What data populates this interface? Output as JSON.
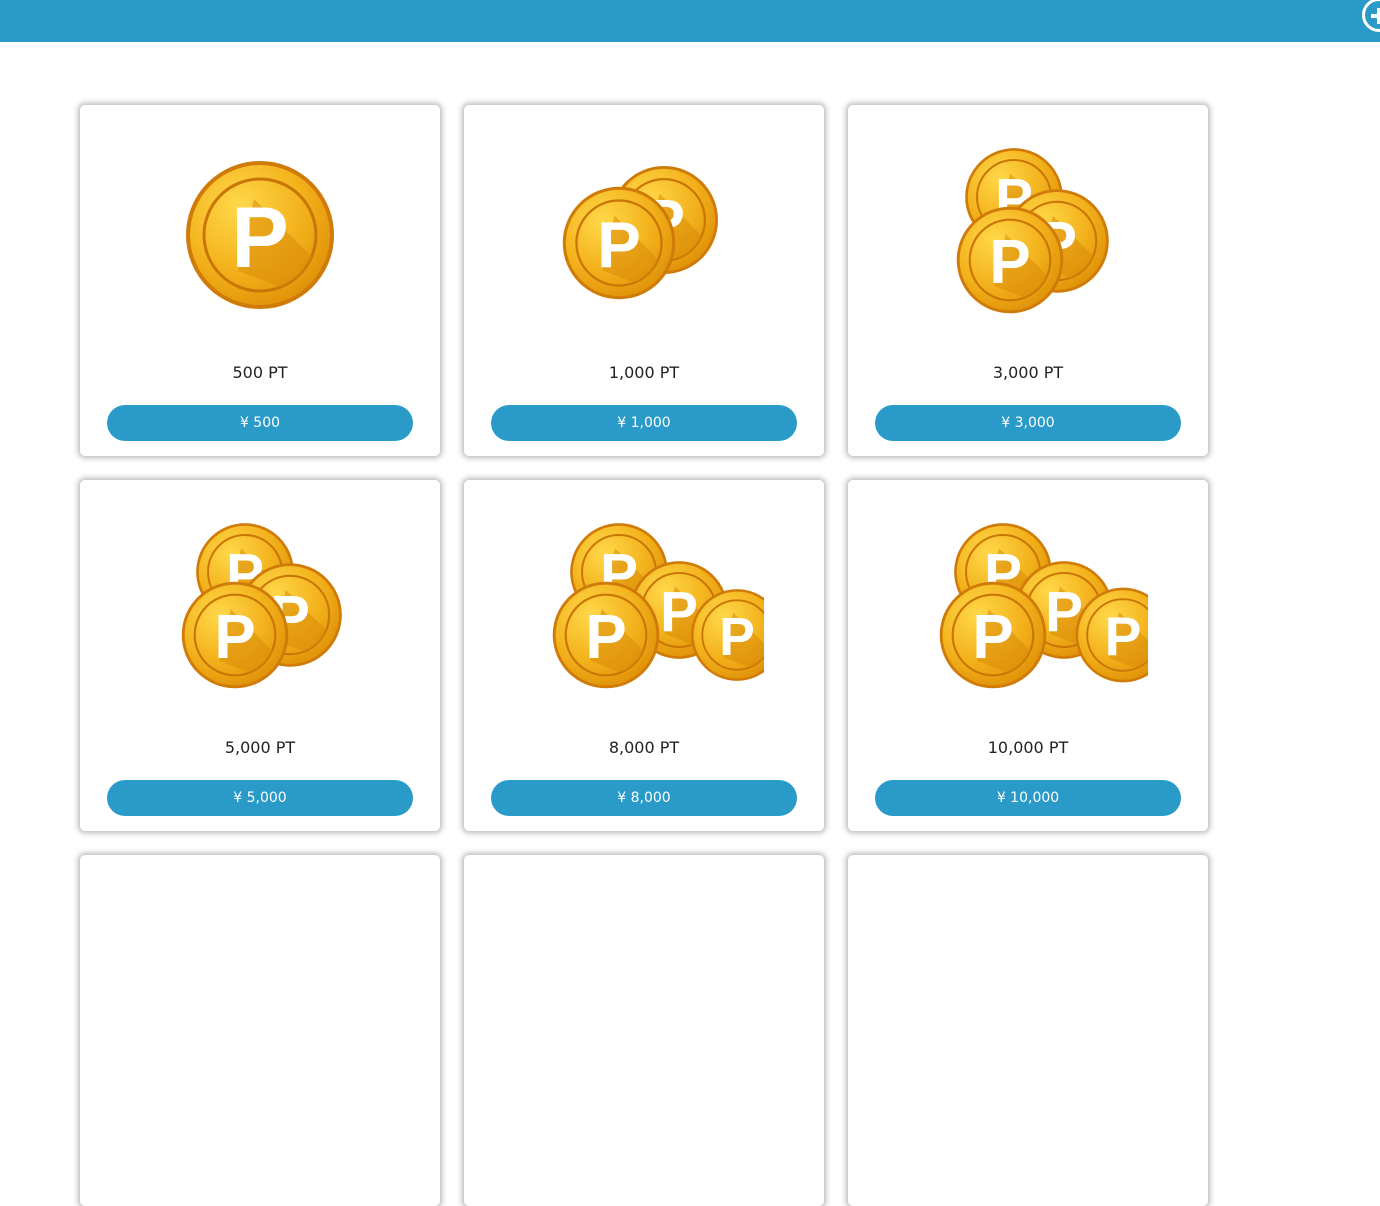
{
  "packages": [
    {
      "points": "500 PT",
      "price": "¥ 500",
      "coin_count": 1
    },
    {
      "points": "1,000 PT",
      "price": "¥ 1,000",
      "coin_count": 2
    },
    {
      "points": "3,000 PT",
      "price": "¥ 3,000",
      "coin_count": 3
    },
    {
      "points": "5,000 PT",
      "price": "¥ 5,000",
      "coin_count": 3
    },
    {
      "points": "8,000 PT",
      "price": "¥ 8,000",
      "coin_count": 4
    },
    {
      "points": "10,000 PT",
      "price": "¥ 10,000",
      "coin_count": 4
    }
  ],
  "colors": {
    "accent": "#2a9bc9",
    "coin": "#f2b01e",
    "coin_dark": "#d98a0a"
  },
  "icons": {
    "coin": "point-coin-icon",
    "add": "plus-icon"
  }
}
